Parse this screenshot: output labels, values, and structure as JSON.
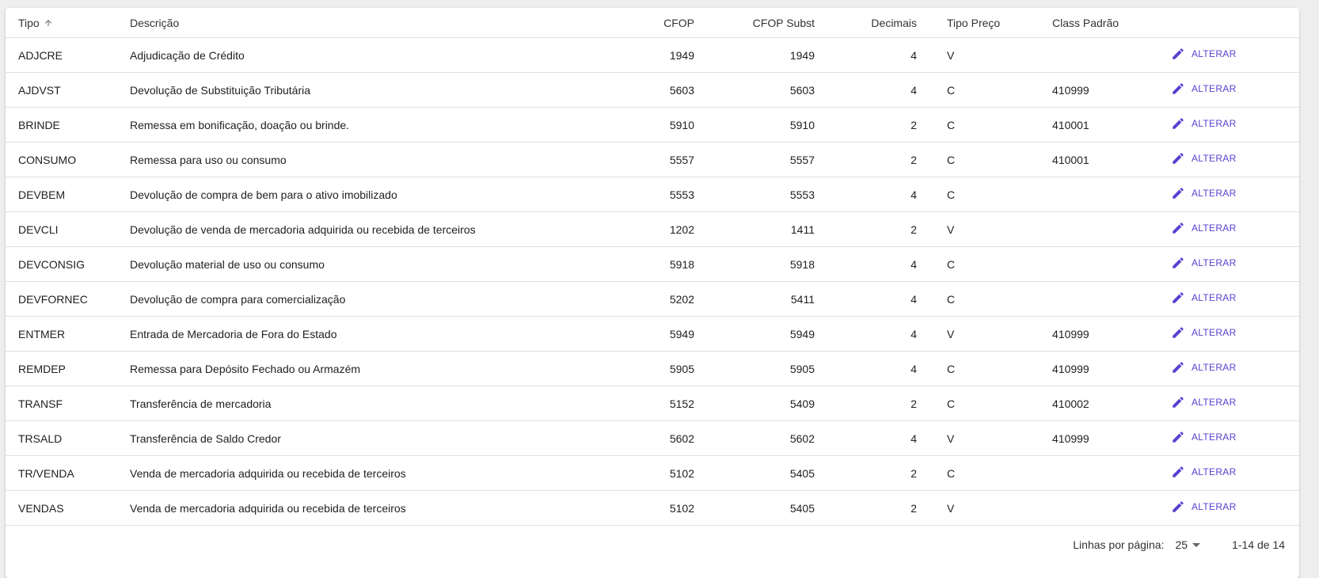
{
  "table": {
    "headers": {
      "tipo": "Tipo",
      "descricao": "Descrição",
      "cfop": "CFOP",
      "cfop_subst": "CFOP Subst",
      "decimais": "Decimais",
      "tipo_preco": "Tipo Preço",
      "class_padrao": "Class Padrão"
    },
    "sort_icon": "arrow-up-icon",
    "action_label": "ALTERAR",
    "action_icon": "pencil-icon",
    "rows": [
      {
        "tipo": "ADJCRE",
        "descricao": "Adjudicação de Crédito",
        "cfop": "1949",
        "cfop_subst": "1949",
        "decimais": "4",
        "tipo_preco": "V",
        "class_padrao": ""
      },
      {
        "tipo": "AJDVST",
        "descricao": "Devolução de Substituição Tributária",
        "cfop": "5603",
        "cfop_subst": "5603",
        "decimais": "4",
        "tipo_preco": "C",
        "class_padrao": "410999"
      },
      {
        "tipo": "BRINDE",
        "descricao": "Remessa em bonificação, doação ou brinde.",
        "cfop": "5910",
        "cfop_subst": "5910",
        "decimais": "2",
        "tipo_preco": "C",
        "class_padrao": "410001"
      },
      {
        "tipo": "CONSUMO",
        "descricao": "Remessa para uso ou consumo",
        "cfop": "5557",
        "cfop_subst": "5557",
        "decimais": "2",
        "tipo_preco": "C",
        "class_padrao": "410001"
      },
      {
        "tipo": "DEVBEM",
        "descricao": "Devolução de compra de bem para o ativo imobilizado",
        "cfop": "5553",
        "cfop_subst": "5553",
        "decimais": "4",
        "tipo_preco": "C",
        "class_padrao": ""
      },
      {
        "tipo": "DEVCLI",
        "descricao": "Devolução de venda de mercadoria adquirida ou recebida de terceiros",
        "cfop": "1202",
        "cfop_subst": "1411",
        "decimais": "2",
        "tipo_preco": "V",
        "class_padrao": ""
      },
      {
        "tipo": "DEVCONSIG",
        "descricao": "Devolução material de uso ou consumo",
        "cfop": "5918",
        "cfop_subst": "5918",
        "decimais": "4",
        "tipo_preco": "C",
        "class_padrao": ""
      },
      {
        "tipo": "DEVFORNEC",
        "descricao": "Devolução de compra para comercialização",
        "cfop": "5202",
        "cfop_subst": "5411",
        "decimais": "4",
        "tipo_preco": "C",
        "class_padrao": ""
      },
      {
        "tipo": "ENTMER",
        "descricao": "Entrada de Mercadoria de Fora do Estado",
        "cfop": "5949",
        "cfop_subst": "5949",
        "decimais": "4",
        "tipo_preco": "V",
        "class_padrao": "410999"
      },
      {
        "tipo": "REMDEP",
        "descricao": "Remessa para Depósito Fechado ou Armazém",
        "cfop": "5905",
        "cfop_subst": "5905",
        "decimais": "4",
        "tipo_preco": "C",
        "class_padrao": "410999"
      },
      {
        "tipo": "TRANSF",
        "descricao": "Transferência de mercadoria",
        "cfop": "5152",
        "cfop_subst": "5409",
        "decimais": "2",
        "tipo_preco": "C",
        "class_padrao": "410002"
      },
      {
        "tipo": "TRSALD",
        "descricao": "Transferência de Saldo Credor",
        "cfop": "5602",
        "cfop_subst": "5602",
        "decimais": "4",
        "tipo_preco": "V",
        "class_padrao": "410999"
      },
      {
        "tipo": "TR/VENDA",
        "descricao": "Venda de mercadoria adquirida ou recebida de terceiros",
        "cfop": "5102",
        "cfop_subst": "5405",
        "decimais": "2",
        "tipo_preco": "C",
        "class_padrao": ""
      },
      {
        "tipo": "VENDAS",
        "descricao": "Venda de mercadoria adquirida ou recebida de terceiros",
        "cfop": "5102",
        "cfop_subst": "5405",
        "decimais": "2",
        "tipo_preco": "V",
        "class_padrao": ""
      }
    ]
  },
  "pagination": {
    "rows_per_page_label": "Linhas por página:",
    "rows_per_page_value": "25",
    "range_label": "1-14 de 14"
  },
  "colors": {
    "accent": "#5b3fd1",
    "background": "#eeeeee",
    "card": "#ffffff",
    "divider": "#e0e0e0"
  }
}
